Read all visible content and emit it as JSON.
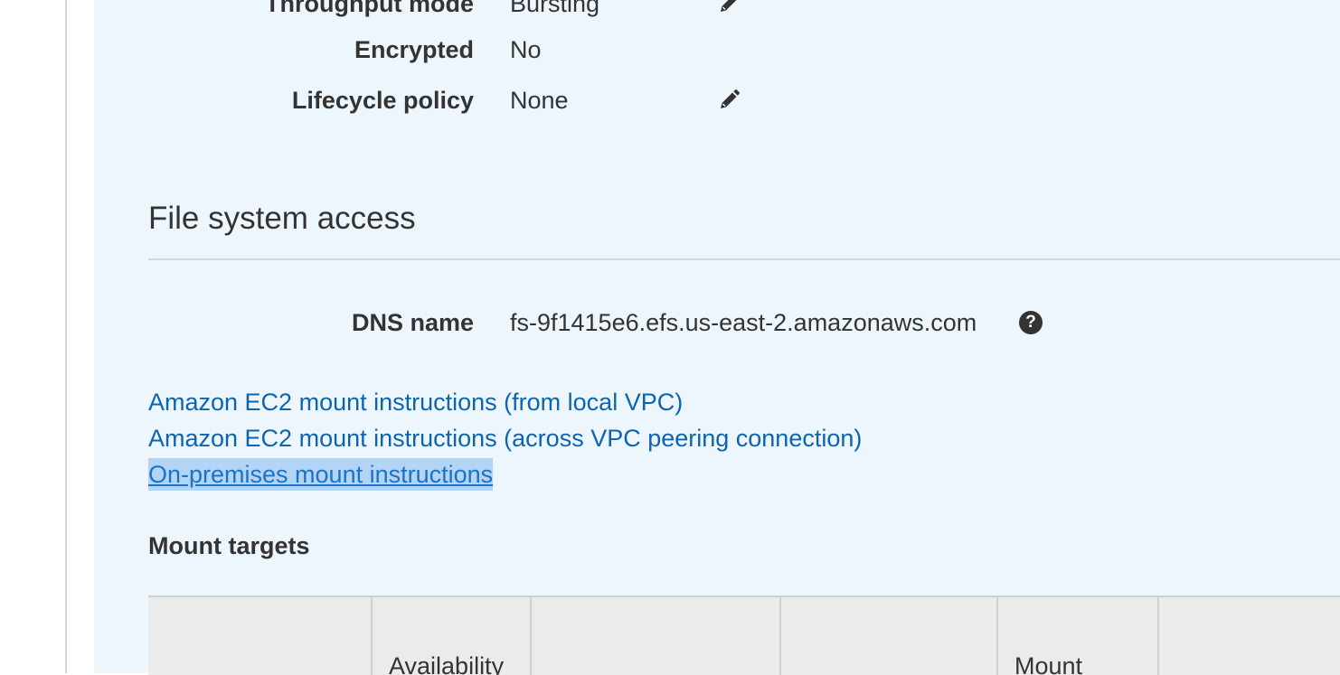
{
  "properties": [
    {
      "label": "Throughput mode",
      "value": "Bursting",
      "editable": true
    },
    {
      "label": "Encrypted",
      "value": "No",
      "editable": false
    },
    {
      "label": "Lifecycle policy",
      "value": "None",
      "editable": true
    }
  ],
  "access": {
    "title": "File system access",
    "dns_label": "DNS name",
    "dns_value": "fs-9f1415e6.efs.us-east-2.amazonaws.com",
    "help_glyph": "?"
  },
  "links": [
    {
      "text": "Amazon EC2 mount instructions (from local VPC)",
      "selected": false
    },
    {
      "text": "Amazon EC2 mount instructions (across VPC peering connection)",
      "selected": false
    },
    {
      "text": "On-premises mount instructions",
      "selected": true
    }
  ],
  "mount_targets": {
    "title": "Mount targets",
    "columns": [
      "",
      "Availability",
      "",
      "",
      "Mount",
      ""
    ]
  },
  "icons": {
    "edit": "pencil-icon",
    "help": "question-circle-icon"
  },
  "colors": {
    "panel_bg": "#eef6fd",
    "link": "#0d64b0",
    "selection": "#b3d4f5",
    "text": "#333333"
  }
}
